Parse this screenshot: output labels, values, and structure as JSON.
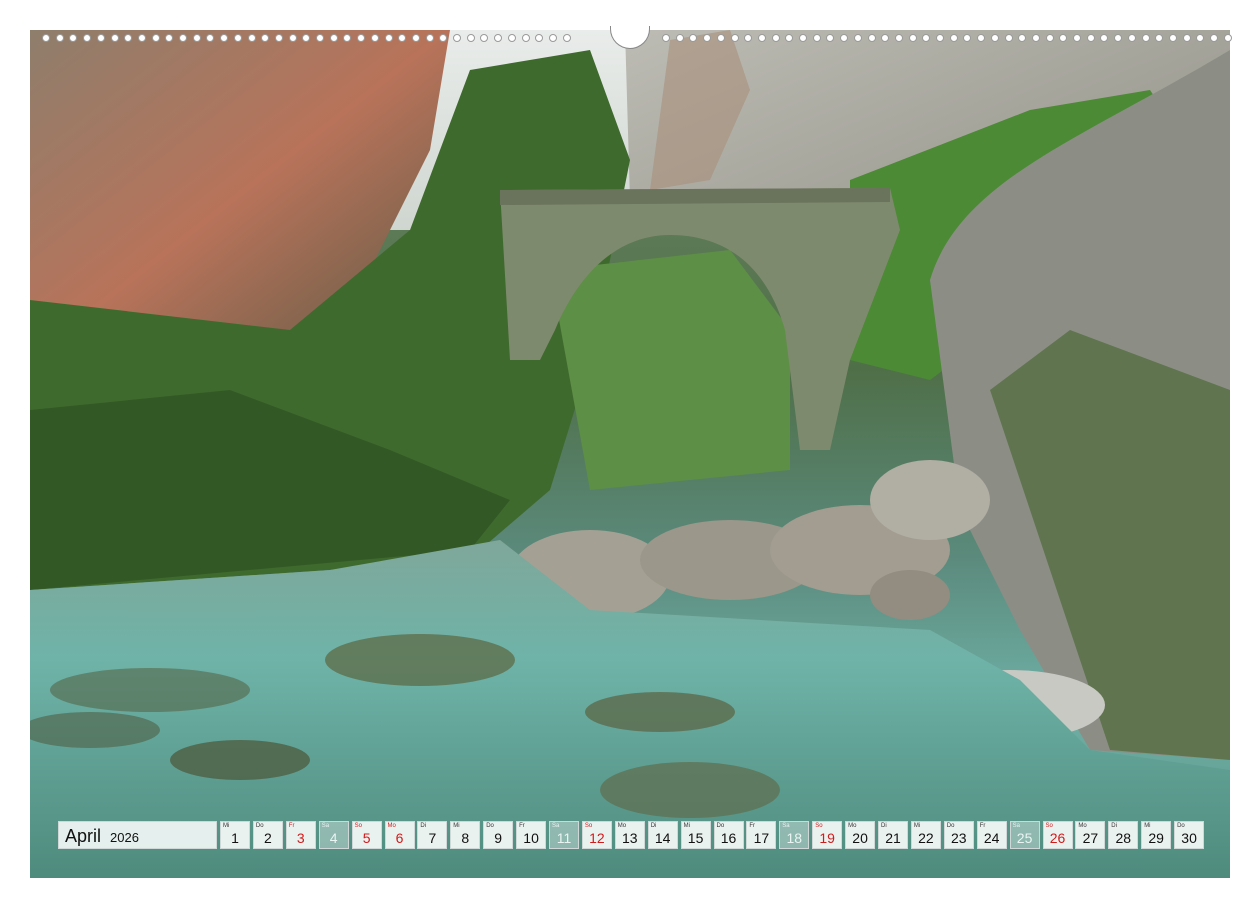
{
  "calendar": {
    "month": "April",
    "year": "2026",
    "days": [
      {
        "dow": "Mi",
        "num": "1",
        "style": "normal"
      },
      {
        "dow": "Do",
        "num": "2",
        "style": "normal"
      },
      {
        "dow": "Fr",
        "num": "3",
        "style": "red"
      },
      {
        "dow": "Sa",
        "num": "4",
        "style": "faded"
      },
      {
        "dow": "So",
        "num": "5",
        "style": "red"
      },
      {
        "dow": "Mo",
        "num": "6",
        "style": "red"
      },
      {
        "dow": "Di",
        "num": "7",
        "style": "normal"
      },
      {
        "dow": "Mi",
        "num": "8",
        "style": "normal"
      },
      {
        "dow": "Do",
        "num": "9",
        "style": "normal"
      },
      {
        "dow": "Fr",
        "num": "10",
        "style": "normal"
      },
      {
        "dow": "Sa",
        "num": "11",
        "style": "faded"
      },
      {
        "dow": "So",
        "num": "12",
        "style": "red"
      },
      {
        "dow": "Mo",
        "num": "13",
        "style": "normal"
      },
      {
        "dow": "Di",
        "num": "14",
        "style": "normal"
      },
      {
        "dow": "Mi",
        "num": "15",
        "style": "normal"
      },
      {
        "dow": "Do",
        "num": "16",
        "style": "normal"
      },
      {
        "dow": "Fr",
        "num": "17",
        "style": "normal"
      },
      {
        "dow": "Sa",
        "num": "18",
        "style": "faded"
      },
      {
        "dow": "So",
        "num": "19",
        "style": "red"
      },
      {
        "dow": "Mo",
        "num": "20",
        "style": "normal"
      },
      {
        "dow": "Di",
        "num": "21",
        "style": "normal"
      },
      {
        "dow": "Mi",
        "num": "22",
        "style": "normal"
      },
      {
        "dow": "Do",
        "num": "23",
        "style": "normal"
      },
      {
        "dow": "Fr",
        "num": "24",
        "style": "normal"
      },
      {
        "dow": "Sa",
        "num": "25",
        "style": "faded"
      },
      {
        "dow": "So",
        "num": "26",
        "style": "red"
      },
      {
        "dow": "Mo",
        "num": "27",
        "style": "normal"
      },
      {
        "dow": "Di",
        "num": "28",
        "style": "normal"
      },
      {
        "dow": "Mi",
        "num": "29",
        "style": "normal"
      },
      {
        "dow": "Do",
        "num": "30",
        "style": "normal"
      }
    ]
  },
  "colors": {
    "holiday_red": "#d21b1b",
    "water_turquoise": "#6fb0a6",
    "foliage_green": "#4f7a3a"
  }
}
